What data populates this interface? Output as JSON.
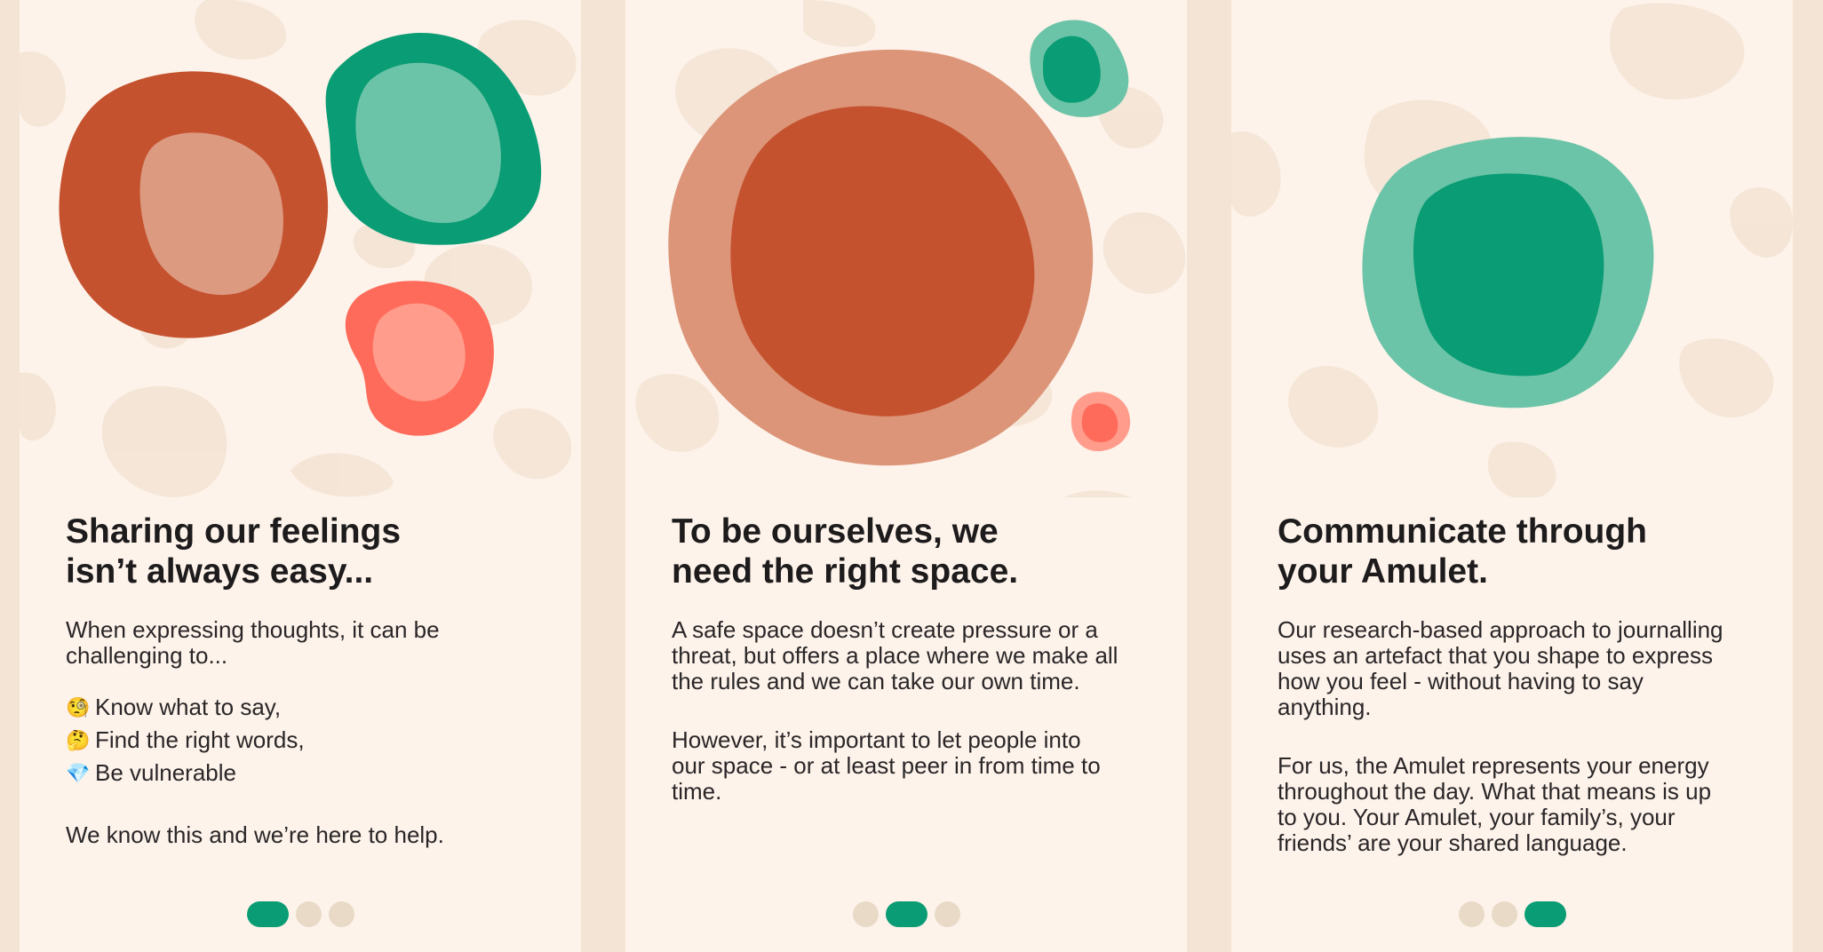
{
  "colors": {
    "background": "#fdf3ea",
    "accent_green": "#0a9c74",
    "rust": "#c5522f",
    "coral": "#ff6b5a",
    "dot_inactive": "#e9dac8"
  },
  "slides": [
    {
      "title_line1": "Sharing our feelings",
      "title_line2": "isn’t always easy...",
      "intro_line1": "When expressing thoughts, it can be",
      "intro_line2": "challenging to...",
      "list": [
        {
          "icon": "thinking-face-icon",
          "glyph": "🧐",
          "text": "Know what to say,"
        },
        {
          "icon": "shushing-face-icon",
          "glyph": "🤔",
          "text": "Find the right words,"
        },
        {
          "icon": "gem-icon",
          "glyph": "💎",
          "text": "Be vulnerable"
        }
      ],
      "closing": "We know this and we’re here to help.",
      "active_dot": 0
    },
    {
      "title_line1": "To be ourselves, we",
      "title_line2": "need the right space.",
      "p1_lines": [
        "A safe space doesn’t create pressure or a",
        "threat, but offers a place where we make all",
        "the rules and we can take our own time."
      ],
      "p2_lines": [
        "However, it’s important to let people into",
        "our space - or at least peer in from time to",
        "time."
      ],
      "active_dot": 1
    },
    {
      "title_line1": "Communicate through",
      "title_line2": "your Amulet.",
      "p1_lines": [
        "Our research-based approach to journalling",
        "uses an artefact that you shape to express",
        "how you feel - without having to say",
        "anything."
      ],
      "p2_lines": [
        "For us, the Amulet represents your energy",
        "throughout the day. What that means is up",
        "to you. Your Amulet, your family’s, your",
        "friends’ are your shared language."
      ],
      "active_dot": 2
    }
  ]
}
